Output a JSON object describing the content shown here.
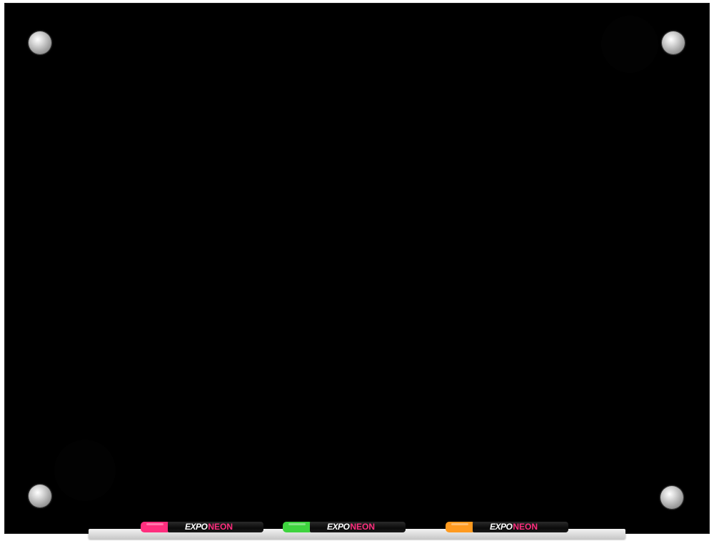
{
  "board": {
    "surface_color": "#000000",
    "standoff_icon": "chrome-standoff",
    "tray_color": "#d8d8d8"
  },
  "markers": [
    {
      "brand": "EXPO",
      "line": "NEON",
      "cap_color": "#ff2e7e",
      "accent_color": "#ff2e7e"
    },
    {
      "brand": "EXPO",
      "line": "NEON",
      "cap_color": "#3ed43e",
      "accent_color": "#ff2e7e"
    },
    {
      "brand": "EXPO",
      "line": "NEON",
      "cap_color": "#ff9a1f",
      "accent_color": "#ff2e7e"
    }
  ]
}
